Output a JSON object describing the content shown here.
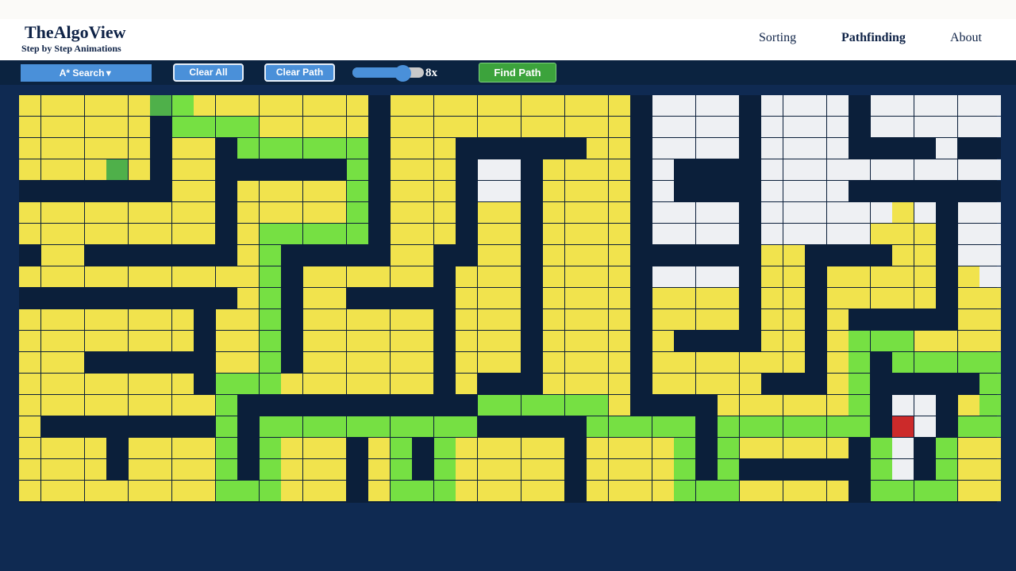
{
  "header": {
    "brand": "TheAlgoView",
    "tagline": "Step by Step Animations",
    "nav": [
      "Sorting",
      "Pathfinding",
      "About"
    ],
    "active_nav": "Pathfinding"
  },
  "toolbar": {
    "algorithm_label": "A* Search",
    "clear_all_label": "Clear All",
    "clear_path_label": "Clear Path",
    "speed_label": "8x",
    "speed_fraction": 0.7,
    "find_path_label": "Find Path"
  },
  "colors": {
    "unvisited": "#eef0f3",
    "visited": "#f1e34d",
    "path": "#76e043",
    "wall": "#0b1f3a",
    "start": "#4fb04a",
    "target": "#cc2a2a",
    "accent": "#4a90d9",
    "action": "#3ca33c"
  },
  "legend": {
    "U": "unvisited",
    "V": "visited",
    "P": "path",
    "W": "wall",
    "S": "start",
    "T": "target"
  },
  "grid": {
    "rows": 19,
    "cols": 45,
    "cells": [
      "VVVVVVSPVVVVVVVVWVVVVVVVVVVVWUUUUWUUUUWUUUUUU",
      "VVVVVVWPPPPVVVVVWVVVVVVVVVVVWUUUUWUUUUWUUUUUU",
      "VVVVVVWVVWPPPPPPWVVVWWWWWWVVWUUUUWUUUUWWWWUWW",
      "VVVVSVWVVWWWWWWPWVVVWUUWVVVVWUWWWWUUUUUUUUUUU",
      "WWWWWWWVVWVVVVVPWVVVWUUWVVVVWUWWWWUUUUWWWWWWW",
      "VVVVVVVVVWVVVVVPWVVVWVVWVVVVWUUUUWUUUUUUVUWUU",
      "VVVVVVVVVWVPPPPPWVVVWVVWVVVVWUUUUWUUUUUVVVWUU",
      "WVVWWWWWWWVPWWWWWVVWWVVWVVVVWWWWWWVVWWWWVVWUU",
      "VVVVVVVVVVVPWVVVVVVWVVVWVVVVWUUUUWVVWVVVVVWVU",
      "WWWWWWWWWWVPWVVWWWWWVVVWVVVVWVVVVWVVWVVVVVWVV",
      "VVVVVVVVWVVPWVVVVVVWVVVWVVVVWVVVVWVVWVWWWWWVV",
      "VVVVVVVVWVVPWVVVVVVWVVVWVVVVWVWWWWVVWVPPPVVVV",
      "VVVWWWWWWVVPWVVVVVVWVVVWVVVVWVVVVVVVWVPWPPPPP",
      "VVVVVVVVWPPPVVVVVVVWVWWWVVVVWVVVVVWWWVPWWWWWP",
      "VVVVVVVVVPWWWWWWWWWWWPPPPPPVWWWWVVVVVVPWUUWVP",
      "VWWWWWWWWPWPPPPPPPPPPWWWWWPPPPPWPPPPPPPWTUWPP",
      "VVVVWVVVVPWPVVVWVPWPVVVVVWVVVVPWPVVVVVWPUWPV",
      "VVVVWVVVVPWPVVVWVPWPVVVVVWVVVVPWPWWWWWWPUWPV",
      "VVVVVVVVVPPPVVVWVPPPVVVVVWVVVVPPPVVVVVWPPPPV"
    ]
  }
}
